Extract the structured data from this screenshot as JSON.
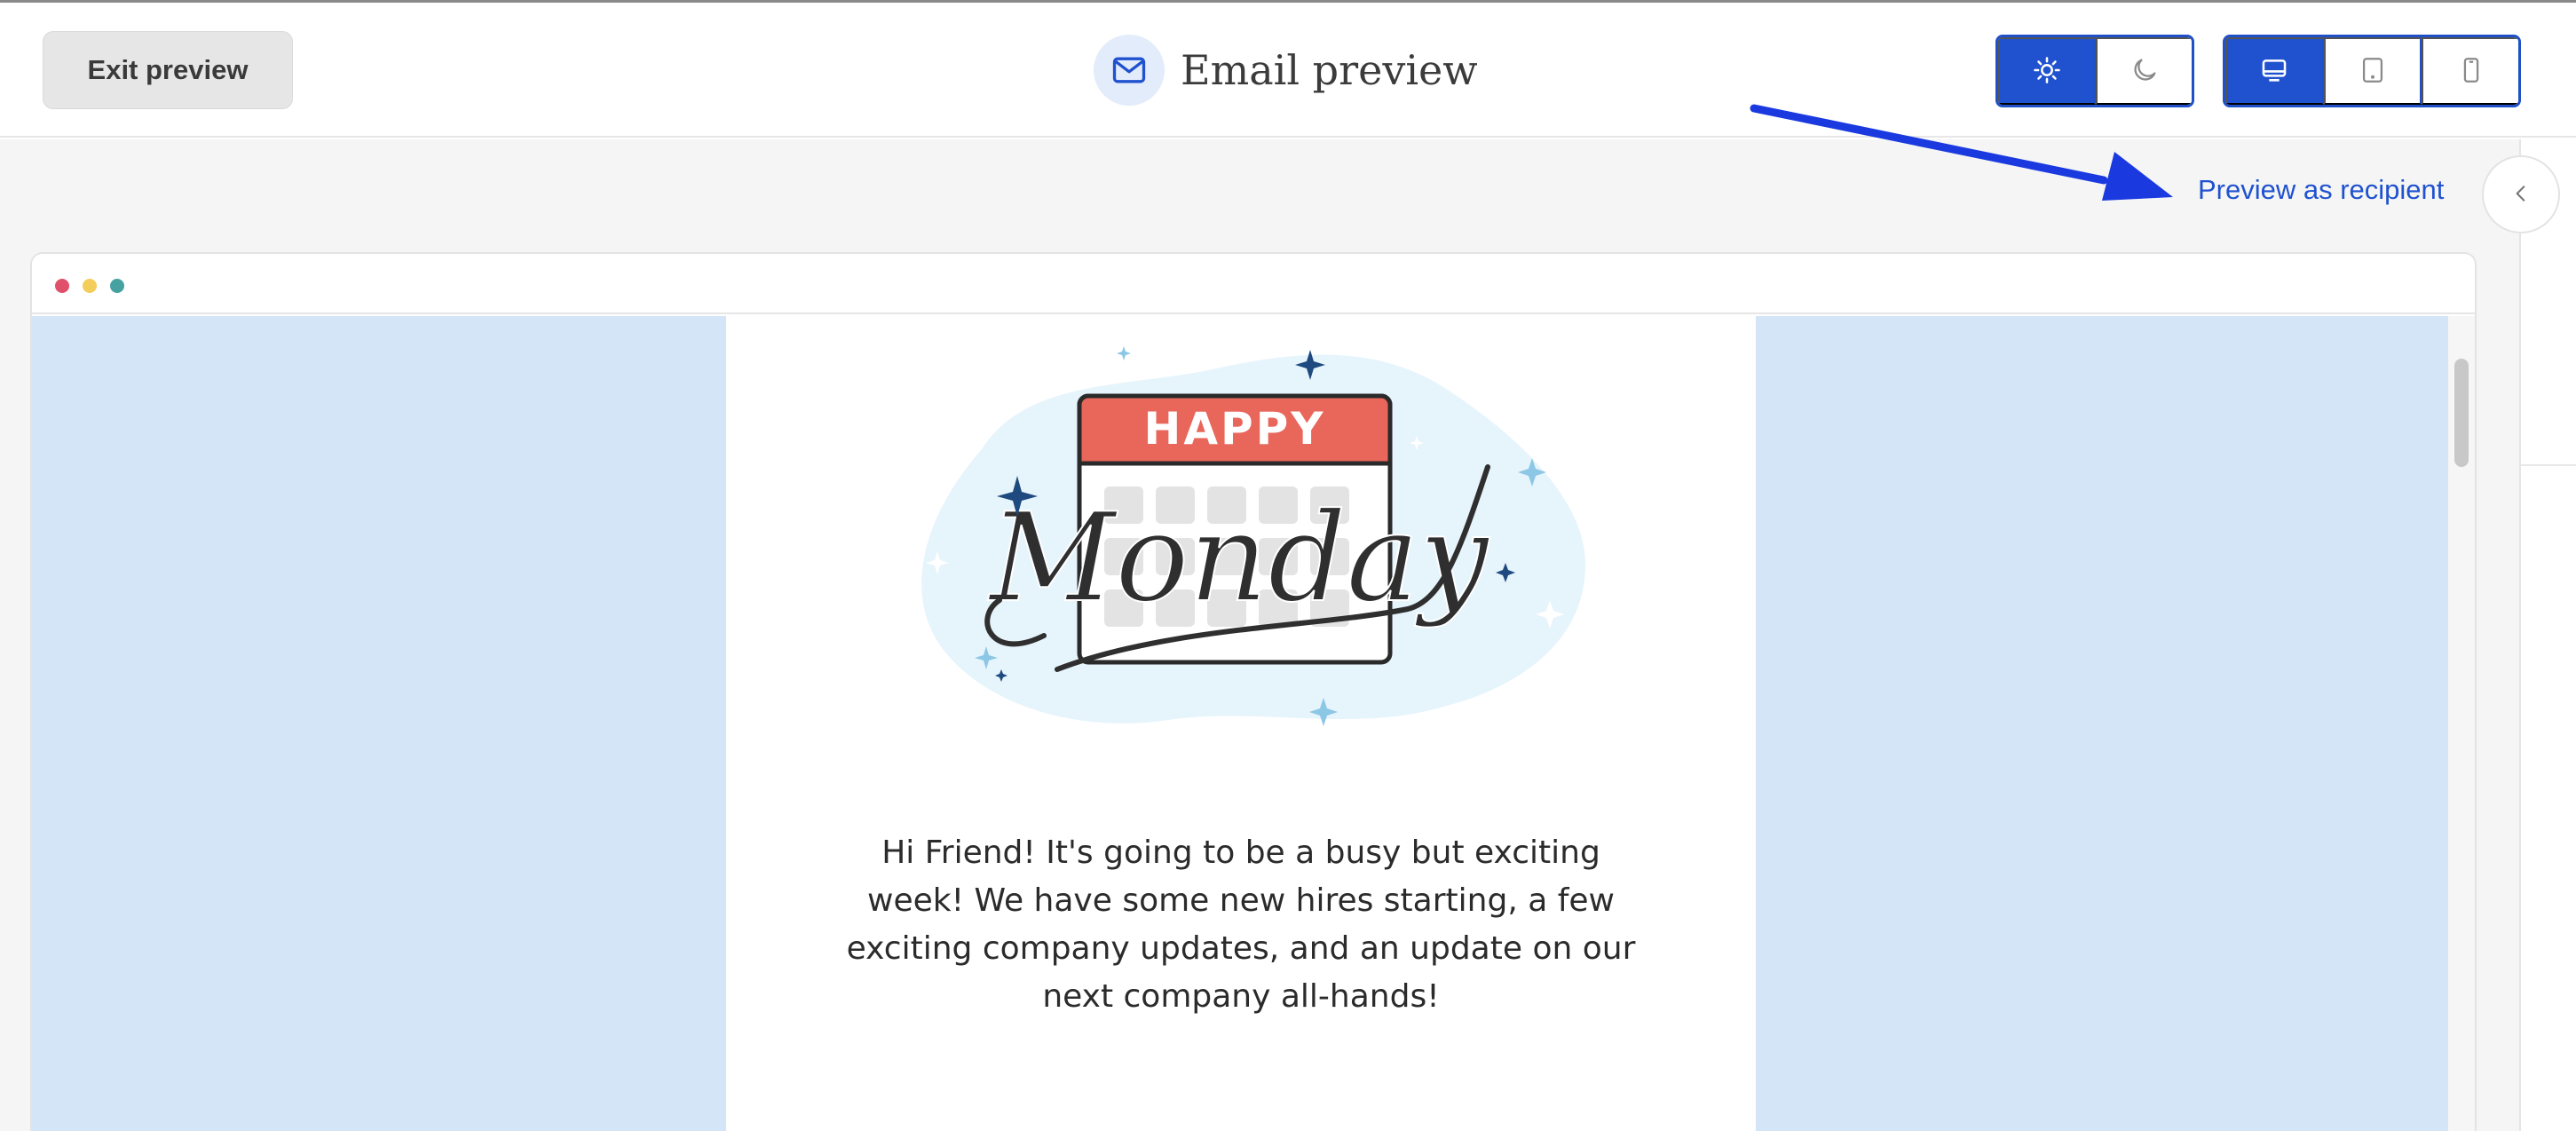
{
  "header": {
    "exit_label": "Exit preview",
    "title": "Email preview",
    "title_icon": "envelope-icon",
    "theme_toggle": [
      {
        "icon": "sun-icon",
        "active": true
      },
      {
        "icon": "moon-icon",
        "active": false
      }
    ],
    "device_toggle": [
      {
        "icon": "desktop-icon",
        "active": true
      },
      {
        "icon": "tablet-icon",
        "active": false
      },
      {
        "icon": "mobile-icon",
        "active": false
      }
    ]
  },
  "preview": {
    "recipient_link": "Preview as recipient",
    "collapse_icon": "chevron-left-icon"
  },
  "email": {
    "hero_banner_text": "HAPPY",
    "hero_script_text": "Monday",
    "body": "Hi Friend! It's going to be a busy but exciting week! We have some new hires starting, a few exciting company updates, and an update on our next company all-hands!"
  },
  "colors": {
    "accent": "#2052cf",
    "email_background": "#d3e5f6",
    "canvas": "#f5f5f5",
    "annotation_arrow": "#1a3ae0",
    "calendar_header": "#e8665a"
  }
}
